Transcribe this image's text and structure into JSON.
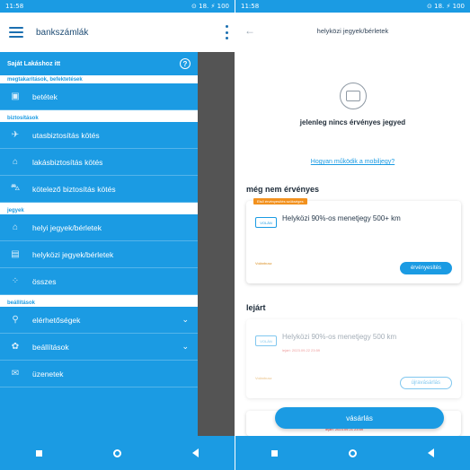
{
  "left": {
    "status": {
      "time": "11:58",
      "right": "⊙ 18. ⚡ 100"
    },
    "appbar": {
      "title": "bankszámlák"
    },
    "drawer": {
      "header": "Saját Lakáshoz itt",
      "sections": {
        "s1": "megtakarítások, befektetések",
        "s2": "biztosítások",
        "s3": "jegyek",
        "s4": "beállítások"
      },
      "items": [
        {
          "label": "betétek",
          "icon": "deposit-icon"
        },
        {
          "label": "utasbiztosítás kötés",
          "icon": "plane-icon"
        },
        {
          "label": "lakásbiztosítás kötés",
          "icon": "home-icon"
        },
        {
          "label": "kötelező biztosítás kötés",
          "icon": "car-icon"
        },
        {
          "label": "helyi jegyek/bérletek",
          "icon": "tram-icon"
        },
        {
          "label": "helyközi jegyek/bérletek",
          "icon": "bus-icon"
        },
        {
          "label": "összes",
          "icon": "grid-icon"
        },
        {
          "label": "elérhetőségek",
          "icon": "location-icon"
        },
        {
          "label": "beállítások",
          "icon": "gear-icon"
        },
        {
          "label": "üzenetek",
          "icon": "mail-icon"
        }
      ]
    }
  },
  "right": {
    "status": {
      "time": "11:58",
      "right": "⊙ 18. ⚡ 100"
    },
    "appbar": {
      "title": "helyközi jegyek/bérletek"
    },
    "empty_text": "jelenleg nincs érvényes jegyed",
    "howto_link": "Hogyan működik a mobiljegy?",
    "section_pending": "még nem érvényes",
    "section_expired": "lejárt",
    "card1": {
      "tag": "Első érvényesítés szükséges",
      "mini": "VOLÁN",
      "title": "Helyközi 90%-os menetjegy 500+ km",
      "brand": "Volánbusz",
      "button": "érvényesítés"
    },
    "card2": {
      "mini": "VOLÁN",
      "title": "Helyközi 90%-os menetjegy 500 km",
      "date": "lejárt: 2023.09.22 23:59",
      "brand": "Volánbusz",
      "button": "újravásárlás"
    },
    "bottom_date": "lejárt: 2023.09.21 23:59",
    "buy_button": "vásárlás"
  }
}
